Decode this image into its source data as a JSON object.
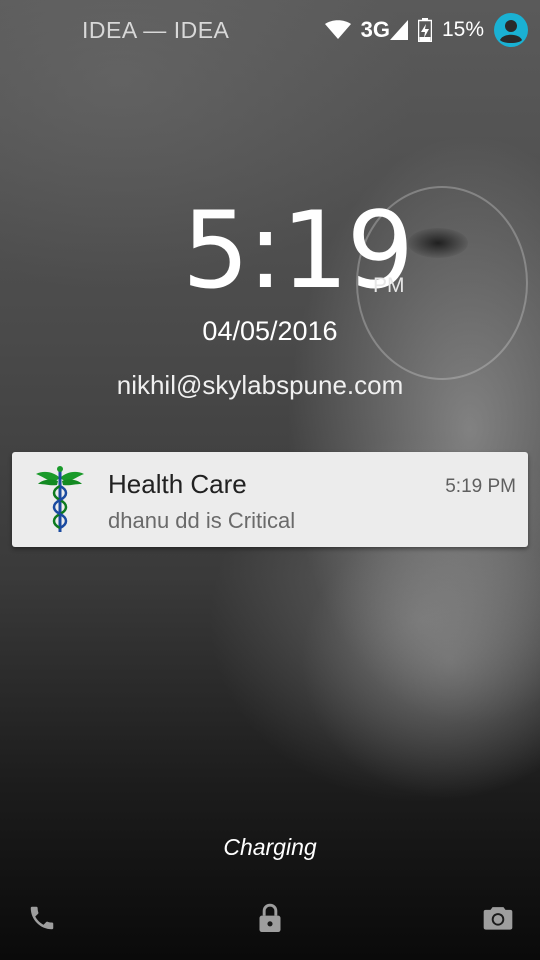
{
  "status_bar": {
    "carrier": "IDEA — IDEA",
    "network": "3G",
    "battery": "15%",
    "icons": [
      "wifi-icon",
      "signal-icon",
      "battery-charging-icon",
      "user-avatar-icon"
    ],
    "avatar_color": "#1ab1d3"
  },
  "clock": {
    "time": "5:19",
    "ampm": "PM",
    "date": "04/05/2016"
  },
  "owner_info": "nikhil@skylabspune.com",
  "notification": {
    "app_icon": "caduceus-icon",
    "title": "Health Care",
    "text": "dhanu dd is Critical",
    "time": "5:19 PM"
  },
  "charging_text": "Charging",
  "bottom_actions": {
    "left": "phone-icon",
    "center": "lock-icon",
    "right": "camera-icon"
  }
}
